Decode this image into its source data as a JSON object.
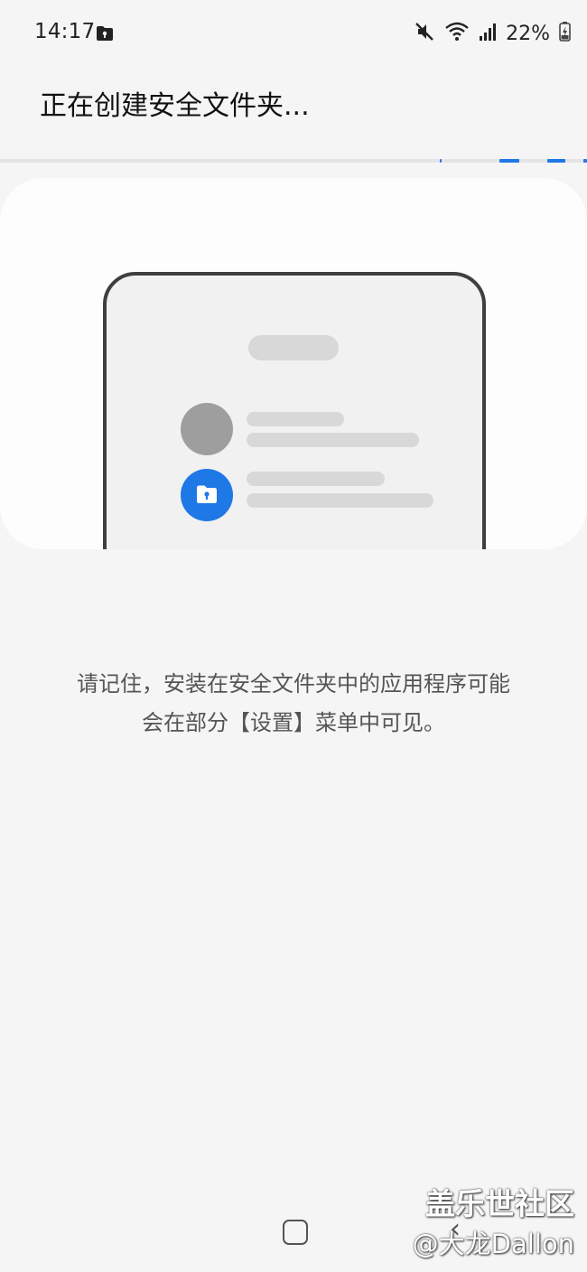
{
  "status_bar": {
    "time": "14:17",
    "battery": "22%",
    "icons": [
      "folder-lock-icon",
      "mute-icon",
      "wifi-icon",
      "signal-icon",
      "battery-charging-icon"
    ]
  },
  "header": {
    "title": "正在创建安全文件夹..."
  },
  "progress": {
    "indeterminate": true,
    "color": "#1e78e6"
  },
  "illustration": {
    "folder_badge_color": "#1e78e6",
    "avatar_color": "#9e9e9e"
  },
  "message": {
    "line1": "请记住，安装在安全文件夹中的应用程序可能",
    "line2": "会在部分【设置】菜单中可见。"
  },
  "watermark": {
    "line1": "盖乐世社区",
    "line2": "@大龙Dallon"
  },
  "navigation": {
    "home": "home-icon",
    "back": "back-icon"
  }
}
